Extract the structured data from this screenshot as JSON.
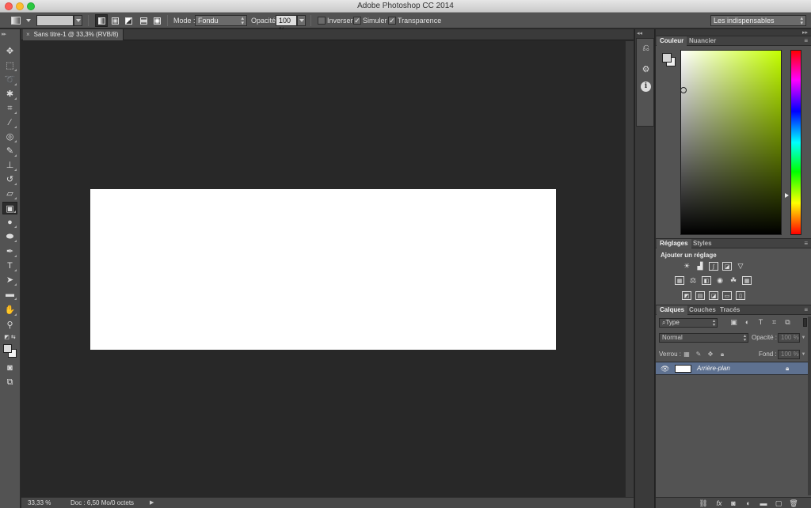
{
  "window": {
    "title": "Adobe Photoshop CC 2014"
  },
  "options_bar": {
    "mode_label": "Mode :",
    "mode_value": "Fondu",
    "opacity_label": "Opacité :",
    "opacity_value": "100 %",
    "inverser_label": "Inverser",
    "inverser_checked": false,
    "simuler_label": "Simuler",
    "simuler_checked": true,
    "transparence_label": "Transparence",
    "transparence_checked": true,
    "workspace_value": "Les indispensables"
  },
  "document": {
    "tab_label": "Sans titre-1 @ 33,3% (RVB/8)",
    "tab_close": "×",
    "canvas_color": "#ffffff"
  },
  "status": {
    "zoom": "33,33 %",
    "doc_info": "Doc : 6,50 Mo/0 octets",
    "arrow": "▶"
  },
  "tools": [
    {
      "name": "move-tool",
      "icon": "move-icon"
    },
    {
      "name": "rectangular-marquee-tool",
      "icon": "marquee-icon"
    },
    {
      "name": "lasso-tool",
      "icon": "lasso-icon"
    },
    {
      "name": "magic-wand-tool",
      "icon": "magic-wand-icon"
    },
    {
      "name": "crop-tool",
      "icon": "crop-icon"
    },
    {
      "name": "eyedropper-tool",
      "icon": "eyedropper-icon"
    },
    {
      "name": "healing-brush-tool",
      "icon": "bandage-icon"
    },
    {
      "name": "brush-tool",
      "icon": "brush-icon"
    },
    {
      "name": "clone-stamp-tool",
      "icon": "stamp-icon"
    },
    {
      "name": "history-brush-tool",
      "icon": "history-brush-icon"
    },
    {
      "name": "eraser-tool",
      "icon": "eraser-icon"
    },
    {
      "name": "gradient-tool",
      "icon": "gradient-icon",
      "active": true
    },
    {
      "name": "blur-tool",
      "icon": "drop-icon"
    },
    {
      "name": "dodge-tool",
      "icon": "dodge-icon"
    },
    {
      "name": "pen-tool",
      "icon": "pen-icon"
    },
    {
      "name": "type-tool",
      "icon": "type-icon"
    },
    {
      "name": "path-selection-tool",
      "icon": "arrow-icon"
    },
    {
      "name": "rectangle-tool",
      "icon": "rectangle-icon"
    },
    {
      "name": "hand-tool",
      "icon": "hand-icon"
    },
    {
      "name": "zoom-tool",
      "icon": "zoom-icon"
    }
  ],
  "colors": {
    "foreground": "#dcdcdc",
    "background": "#f4f4f4",
    "layer_selected": "#5e7190"
  },
  "color_panel": {
    "tab_active": "Couleur",
    "tab_other": "Nuancier",
    "hue_color": "#c4ff00"
  },
  "adjustments_panel": {
    "tab_active": "Réglages",
    "tab_other": "Styles",
    "title": "Ajouter un réglage"
  },
  "layers_panel": {
    "tab_active": "Calques",
    "tab_channels": "Couches",
    "tab_paths": "Tracés",
    "filter_value": "Type",
    "blend_mode": "Normal",
    "opacity_label": "Opacité :",
    "opacity_value": "100 %",
    "lock_label": "Verrou :",
    "fill_label": "Fond :",
    "fill_value": "100 %",
    "layers": [
      {
        "name": "Arrière-plan",
        "visible": true,
        "locked": true,
        "selected": true
      }
    ]
  }
}
